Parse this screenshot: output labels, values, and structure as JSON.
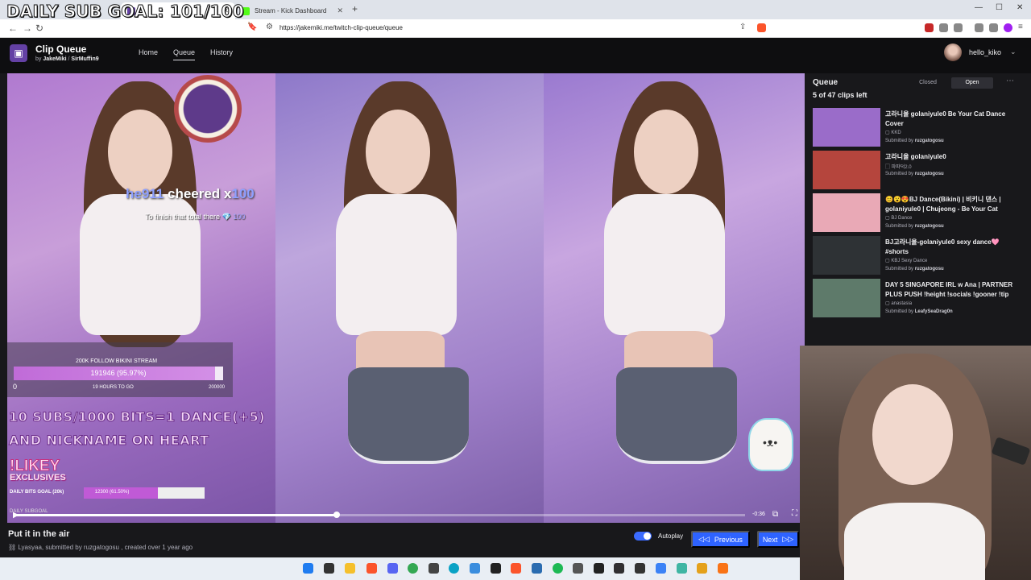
{
  "overlay": {
    "daily_sub_goal": "DAILY SUB GOAL: 101/100"
  },
  "browser": {
    "tabs": [
      {
        "label": "Stream - Kick Dashboard",
        "favicon_color": "#53fc18"
      }
    ],
    "url": "https://jakemiki.me/twitch-clip-queue/queue"
  },
  "app": {
    "title": "Clip Queue",
    "by_prefix": "by",
    "author1": "JakeMiki",
    "separator": "/",
    "author2": "SirMuffin9",
    "nav": [
      "Home",
      "Queue",
      "History"
    ],
    "active_nav": "Queue",
    "username": "hello_kiko",
    "accent": "#6441a5"
  },
  "video": {
    "cheer": {
      "name": "he911",
      "middle": " cheered x",
      "amount": "100",
      "sub_prefix": "To finish that total there",
      "sub_amount": "100"
    },
    "follow_goal": {
      "title": "200K FOLLOW BIKINI STREAM",
      "value_text": "191946 (95.97%)",
      "progress": 0.9597,
      "min": "0",
      "hours": "19 HOURS TO GO",
      "max": "200000"
    },
    "sub_lines": [
      "10 SUBS/1000 BITS=1 DANCE(+5)",
      "AND NICKNAME ON HEART"
    ],
    "likey": "!LIKEY",
    "exclusives": "EXCLUSIVES",
    "bits_goal": {
      "label": "DAILY BITS GOAL (20k)",
      "value_text": "12300 (61.50%)",
      "progress": 0.615
    },
    "subgoal_mini": "DAILY SUBGOAL",
    "seek_progress": 0.44,
    "time_left": "-0:36"
  },
  "clip": {
    "title": "Put it in the air",
    "channel": "Lyasyaa",
    "meta": ", submitted by ruzgatogosu , created over 1 year ago",
    "autoplay_label": "Autoplay",
    "autoplay_on": true,
    "previous_label": "Previous",
    "next_label": "Next"
  },
  "queue": {
    "title": "Queue",
    "count": "5 of 47 clips left",
    "closed_label": "Closed",
    "open_label": "Open",
    "submitted_prefix": "Submitted by",
    "items": [
      {
        "title": "고라니율 golaniyule0 Be Your Cat Dance Cover",
        "category": "KKD",
        "submitter": "ruzgatogosu",
        "thumb": "#9a6cc9"
      },
      {
        "title": "고라니율 golaniyule0",
        "category": "퍄퍄덕2.0",
        "submitter": "ruzgatogosu",
        "thumb": "#b5453d"
      },
      {
        "title": "😊😮😍BJ Dance(Bikini) | 비키니 댄스 | golaniyule0 | Chujeong - Be Your Cat",
        "category": "BJ Dance",
        "submitter": "ruzgatogosu",
        "thumb": "#e9a9b6"
      },
      {
        "title": "BJ고라니율-golaniyule0 sexy dance🩷 #shorts",
        "category": "KBJ Sexy Dance",
        "submitter": "ruzgatogosu",
        "thumb": "#2e3235"
      },
      {
        "title": "DAY 5 SINGAPORE IRL w Ana | PARTNER PLUS PUSH !height !socials !gooner !tip",
        "category": "anastasia",
        "submitter": "LeafySeaDrag0n",
        "thumb": "#5e7a6a"
      }
    ]
  }
}
